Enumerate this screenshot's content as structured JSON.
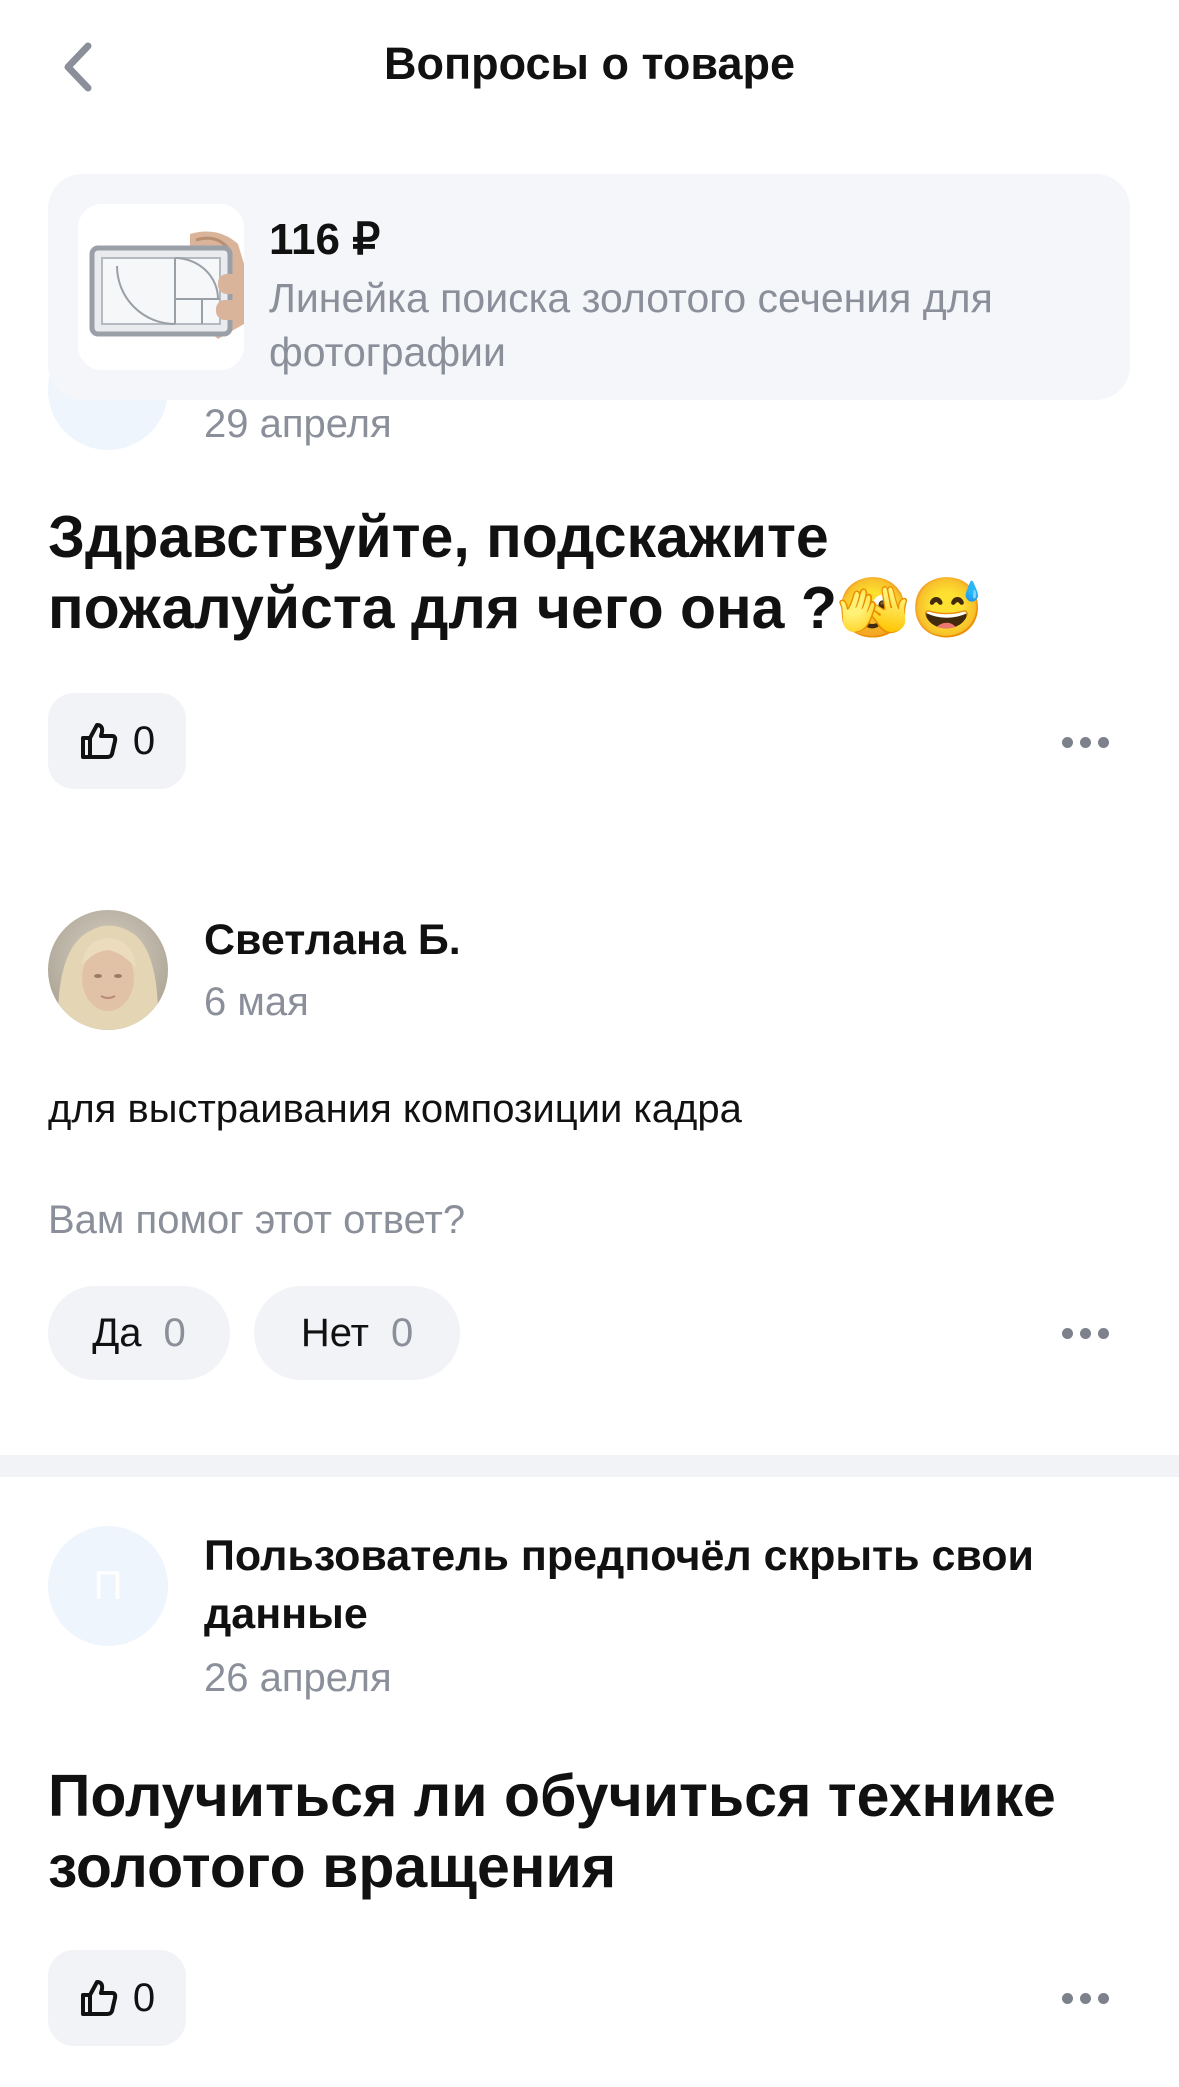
{
  "header": {
    "title": "Вопросы о товаре"
  },
  "product": {
    "price": "116 ₽",
    "name": "Линейка поиска золотого сечения для фотографии"
  },
  "questions": [
    {
      "date": "29 апреля",
      "text": "Здравствуйте, подскажите пожалуйста для чего она ?🫣😅",
      "likes": "0"
    },
    {
      "author": "Пользователь предпочёл скрыть свои данные",
      "avatar_letter": "П",
      "date": "26 апреля",
      "text": "Получиться ли обучиться технике золотого вращения",
      "likes": "0"
    }
  ],
  "answer": {
    "author": "Светлана Б.",
    "date": "6 мая",
    "text": "для выстраивания композиции кадра",
    "helpful_prompt": "Вам помог этот ответ?",
    "yes_label": "Да",
    "yes_count": "0",
    "no_label": "Нет",
    "no_count": "0"
  },
  "icons": {
    "back": "chevron-left-icon",
    "like": "thumbs-up-icon",
    "more": "more-horizontal-icon"
  },
  "colors": {
    "text": "#111111",
    "secondary": "#8a8f9a",
    "chip_bg": "#f2f3f6",
    "card_bg": "#f5f6f9",
    "avatar_placeholder": "#eef5fd"
  }
}
